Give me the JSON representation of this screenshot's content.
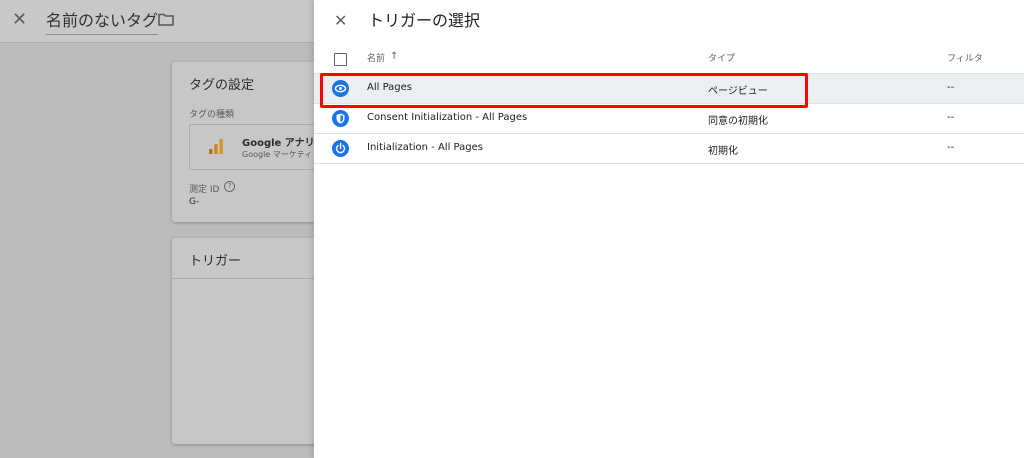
{
  "background": {
    "header_title": "名前のないタグ",
    "settings_card": {
      "title": "タグの設定",
      "tag_type_label": "タグの種類",
      "tag_type_name": "Google アナリテ",
      "tag_type_sub": "Google マーケティ",
      "measurement_label": "測定 ID",
      "measurement_help": "?",
      "measurement_value": "G-"
    },
    "trigger_card": {
      "title": "トリガー"
    }
  },
  "drawer": {
    "close_glyph": "✕",
    "title": "トリガーの選択",
    "table": {
      "headers": {
        "name": "名前",
        "sort_glyph": "↑",
        "type": "タイプ",
        "filter": "フィルタ"
      },
      "rows": [
        {
          "name": "All Pages",
          "type": "ページビュー",
          "filter": "--",
          "icon": "eye-icon",
          "selected": true
        },
        {
          "name": "Consent Initialization - All Pages",
          "type": "同意の初期化",
          "filter": "--",
          "icon": "shield-icon",
          "selected": false
        },
        {
          "name": "Initialization - All Pages",
          "type": "初期化",
          "filter": "--",
          "icon": "power-icon",
          "selected": false
        }
      ]
    }
  },
  "colors": {
    "accent_blue": "#1a73e8",
    "highlight_red": "#ff0000",
    "overlay_gray": "#bcbcbc"
  }
}
